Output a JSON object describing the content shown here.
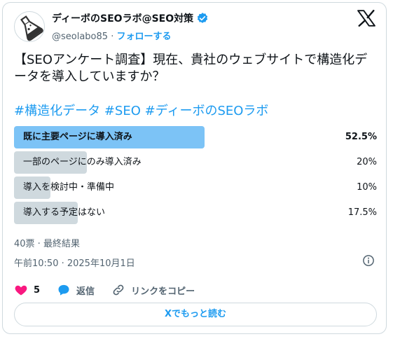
{
  "author": {
    "display_name": "ディーボのSEOラボ@SEO対策",
    "handle": "@seolabo85",
    "separator": " · ",
    "follow_label": "フォローする"
  },
  "tweet": {
    "text": "【SEOアンケート調査】現在、貴社のウェブサイトで構造化データを導入していますか？",
    "hashtags": [
      "#構造化データ",
      "#SEO",
      "#ディーボのSEOラボ"
    ]
  },
  "poll": {
    "options": [
      {
        "label": "既に主要ページに導入済み",
        "percent_text": "52.5%",
        "fraction": 0.525,
        "winner": true
      },
      {
        "label": "一部のページにのみ導入済み",
        "percent_text": "20%",
        "fraction": 0.2,
        "winner": false
      },
      {
        "label": "導入を検討中・準備中",
        "percent_text": "10%",
        "fraction": 0.1,
        "winner": false
      },
      {
        "label": "導入する予定はない",
        "percent_text": "17.5%",
        "fraction": 0.175,
        "winner": false
      }
    ],
    "summary": "40票 · 最終結果"
  },
  "timestamp": "午前10:50 · 2025年10月1日",
  "actions": {
    "like_count": "5",
    "reply_label": "返信",
    "copy_link_label": "リンクをコピー"
  },
  "read_more_label": "Xでもっと読む",
  "colors": {
    "accent": "#1d9bf0",
    "winner_bar": "#7cc3f6",
    "bar": "#cfd9de",
    "like": "#f91880",
    "text_secondary": "#536471"
  }
}
